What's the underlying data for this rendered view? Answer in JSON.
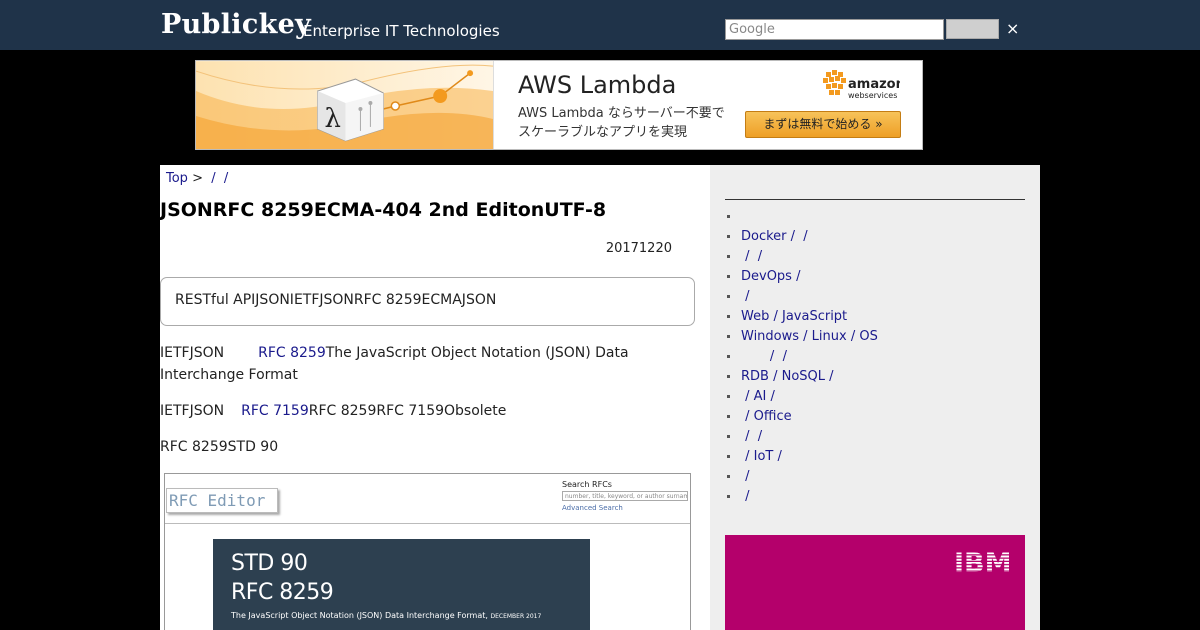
{
  "header": {
    "logo": "Publickey",
    "tagline": "Enterprise IT Technologies",
    "search_placeholder": "Google",
    "close_symbol": "×"
  },
  "ad": {
    "title": "AWS Lambda",
    "line1": "AWS Lambda ならサーバー不要で",
    "line2": "スケーラブルなアプリを実現",
    "cta": "まずは無料で始める »",
    "brand": "amazon webservices",
    "brand_line1": "amazon",
    "brand_line2": "webservices"
  },
  "breadcrumb": {
    "top": "Top",
    "sep1": " >  ",
    "crumb1": "/",
    "crumb2": "/"
  },
  "article": {
    "title": "JSONRFC 8259ECMA-404 2nd EditonUTF-8",
    "date": "20171220",
    "summary": "RESTful APIJSONIETFJSONRFC 8259ECMAJSON",
    "p1_pre": "IETFJSON",
    "p1_link": "RFC 8259",
    "p1_post": "The JavaScript Object Notation (JSON) Data Interchange Format",
    "p2_pre": "IETFJSON",
    "p2_link": "RFC 7159",
    "p2_post": "RFC 8259RFC 7159Obsolete",
    "p3": "RFC 8259STD 90"
  },
  "figure": {
    "logo": "RFC Editor",
    "search_label": "Search RFCs",
    "search_placeholder": "number, title, keyword, or author surname",
    "advanced": "Advanced Search",
    "std": "STD 90",
    "rfc": "RFC 8259",
    "subtitle": "The JavaScript Object Notation (JSON) Data Interchange Format,",
    "subtitle_date": "DECEMBER 2017"
  },
  "sidebar": {
    "categories": [
      "",
      "Docker /  /",
      " /  /",
      "DevOps /",
      " /",
      "Web / JavaScript",
      "Windows / Linux / OS",
      "       /  /",
      "RDB / NoSQL /",
      " / AI /",
      " / Office",
      " /  /",
      " / IoT /",
      " /",
      " /"
    ],
    "ibm_logo": "IBM"
  },
  "colors": {
    "header_bg": "#1f3349",
    "link": "#1a1a8c",
    "ibm_ad_bg": "#b4006b",
    "rfc_panel_bg": "#2d4050"
  }
}
